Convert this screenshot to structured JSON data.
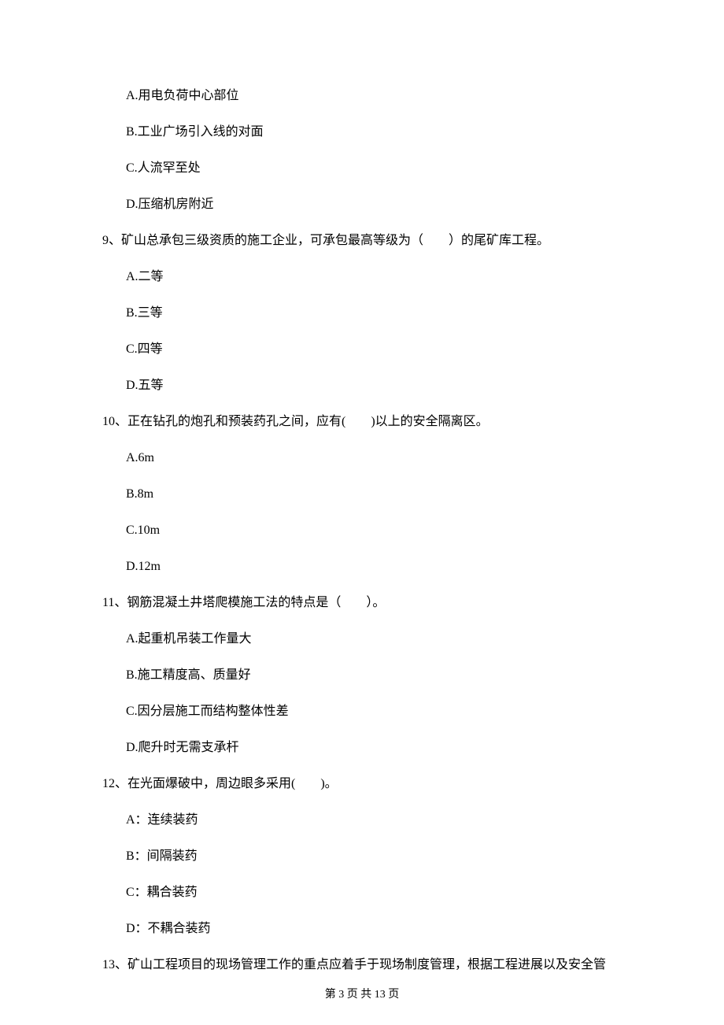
{
  "q8_options": {
    "A": "A.用电负荷中心部位",
    "B": "B.工业广场引入线的对面",
    "C": "C.人流罕至处",
    "D": "D.压缩机房附近"
  },
  "q9": {
    "text": "9、矿山总承包三级资质的施工企业，可承包最高等级为（　　）的尾矿库工程。",
    "A": "A.二等",
    "B": "B.三等",
    "C": "C.四等",
    "D": "D.五等"
  },
  "q10": {
    "text": "10、正在钻孔的炮孔和预装药孔之间，应有(　　)以上的安全隔离区。",
    "A": "A.6m",
    "B": "B.8m",
    "C": "C.10m",
    "D": "D.12m"
  },
  "q11": {
    "text": "11、钢筋混凝土井塔爬模施工法的特点是（　　）。",
    "A": "A.起重机吊装工作量大",
    "B": "B.施工精度高、质量好",
    "C": "C.因分层施工而结构整体性差",
    "D": "D.爬升时无需支承杆"
  },
  "q12": {
    "text": "12、在光面爆破中，周边眼多采用(　　)。",
    "A": "A：连续装药",
    "B": "B：间隔装药",
    "C": "C：耦合装药",
    "D": "D：不耦合装药"
  },
  "q13": {
    "text": "13、矿山工程项目的现场管理工作的重点应着手于现场制度管理，根据工程进展以及安全管"
  },
  "footer": "第 3 页 共 13 页"
}
